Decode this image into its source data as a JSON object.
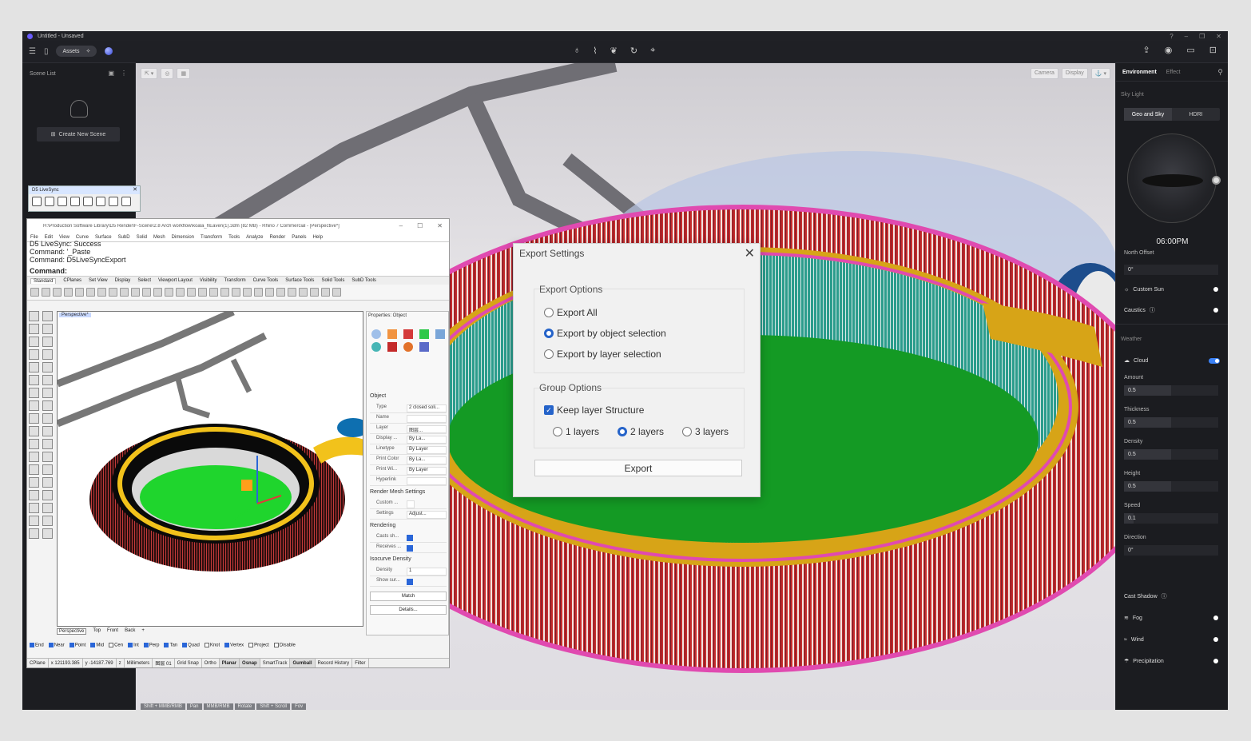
{
  "app": {
    "title": "Untitled - Unsaved",
    "window_controls": [
      "?",
      "–",
      "❐",
      "✕"
    ],
    "toolbar": {
      "assets_label": "Assets",
      "menu_icon": "hamburger-icon",
      "center_tools": [
        "light-bulb-icon",
        "path-icon",
        "leaf-icon",
        "rotate-icon",
        "brush-icon"
      ],
      "right_tools": [
        "share-icon",
        "camera-icon",
        "video-icon",
        "inbox-icon"
      ]
    }
  },
  "scene_list": {
    "title": "Scene List",
    "create_label": "Create New Scene"
  },
  "viewport": {
    "right_buttons": [
      "Camera",
      "Display"
    ],
    "shortcut_hints": [
      "Shift + MMB/RMB",
      "Pan",
      "MMB/RMB",
      "Rotate",
      "Shift + Scroll",
      "Fov"
    ]
  },
  "livesync": {
    "title": "D5 LiveSync"
  },
  "rhino": {
    "title": "H:\\Production Software Library\\D5 Render\\F-Scene\\2.8 Arch workflow\\koala_hEaven(1).3dm (82 MB) - Rhino 7 Commercial - [Perspective*]",
    "menu": [
      "File",
      "Edit",
      "View",
      "Curve",
      "Surface",
      "SubD",
      "Solid",
      "Mesh",
      "Dimension",
      "Transform",
      "Tools",
      "Analyze",
      "Render",
      "Panels",
      "Help"
    ],
    "command_history": [
      "D5 LiveSync: Success",
      "Command: '_Paste",
      "Command: D5LiveSyncExport"
    ],
    "command_prompt": "Command:",
    "tabs": [
      "Standard",
      "CPlanes",
      "Set View",
      "Display",
      "Select",
      "Viewport Layout",
      "Visibility",
      "Transform",
      "Curve Tools",
      "Surface Tools",
      "Solid Tools",
      "SubD Tools"
    ],
    "viewport_label": "Perspective*",
    "view_tabs": [
      "Perspective",
      "Top",
      "Front",
      "Back"
    ],
    "osnaps": [
      {
        "label": "End",
        "on": true
      },
      {
        "label": "Near",
        "on": true
      },
      {
        "label": "Point",
        "on": true
      },
      {
        "label": "Mid",
        "on": true
      },
      {
        "label": "Cen",
        "on": false
      },
      {
        "label": "Int",
        "on": true
      },
      {
        "label": "Perp",
        "on": true
      },
      {
        "label": "Tan",
        "on": true
      },
      {
        "label": "Quad",
        "on": true
      },
      {
        "label": "Knot",
        "on": false
      },
      {
        "label": "Vertex",
        "on": true
      },
      {
        "label": "Project",
        "on": false
      },
      {
        "label": "Disable",
        "on": false
      }
    ],
    "status": [
      "CPlane",
      "x 121193.385",
      "y -14187.769",
      "z",
      "Millimeters",
      "图层 01",
      "Grid Snap",
      "Ortho",
      "Planar",
      "Osnap",
      "SmartTrack",
      "Gumball",
      "Record History",
      "Filter"
    ],
    "properties": {
      "title": "Properties: Object",
      "object_section": "Object",
      "rows": [
        {
          "k": "Type",
          "v": "2 closed soli..."
        },
        {
          "k": "Name",
          "v": ""
        },
        {
          "k": "Layer",
          "v": "图层..."
        },
        {
          "k": "Display ...",
          "v": "By La..."
        },
        {
          "k": "Linetype",
          "v": "By Layer"
        },
        {
          "k": "Print Color",
          "v": "By La..."
        },
        {
          "k": "Print Wi...",
          "v": "By Layer"
        },
        {
          "k": "Hyperlink",
          "v": ""
        }
      ],
      "render_mesh_section": "Render Mesh Settings",
      "custom_label": "Custom ...",
      "settings_label": "Settings",
      "adjust_label": "Adjust...",
      "rendering_section": "Rendering",
      "casts_label": "Casts sh...",
      "receives_label": "Receives ...",
      "isocurve_section": "Isocurve Density",
      "density_label": "Density",
      "density_value": "1",
      "show_label": "Show sur...",
      "match_label": "Match",
      "details_label": "Details..."
    }
  },
  "export_dialog": {
    "title": "Export Settings",
    "export_options_label": "Export Options",
    "options": [
      "Export All",
      "Export by object selection",
      "Export by layer selection"
    ],
    "selected_option": 1,
    "group_options_label": "Group Options",
    "keep_layer_label": "Keep layer Structure",
    "layer_options": [
      "1 layers",
      "2 layers",
      "3 layers"
    ],
    "selected_layer": 1,
    "export_button": "Export"
  },
  "environment": {
    "tabs": [
      "Environment",
      "Effect"
    ],
    "sky_light_label": "Sky Light",
    "sky_modes": [
      "Geo and Sky",
      "HDRI"
    ],
    "time": "06:00PM",
    "north_offset_label": "North Offset",
    "north_offset_value": "0°",
    "custom_sun_label": "Custom Sun",
    "caustics_label": "Caustics",
    "weather_label": "Weather",
    "cloud_label": "Cloud",
    "params": [
      {
        "label": "Amount",
        "value": "0.5",
        "level": 0.5
      },
      {
        "label": "Thickness",
        "value": "0.5",
        "level": 0.5
      },
      {
        "label": "Density",
        "value": "0.5",
        "level": 0.5
      },
      {
        "label": "Height",
        "value": "0.5",
        "level": 0.5
      },
      {
        "label": "Speed",
        "value": "0.1",
        "level": 0.1
      },
      {
        "label": "Direction",
        "value": "0°",
        "level": 0
      }
    ],
    "cast_shadow_label": "Cast Shadow",
    "fog_label": "Fog",
    "wind_label": "Wind",
    "precipitation_label": "Precipitation"
  }
}
